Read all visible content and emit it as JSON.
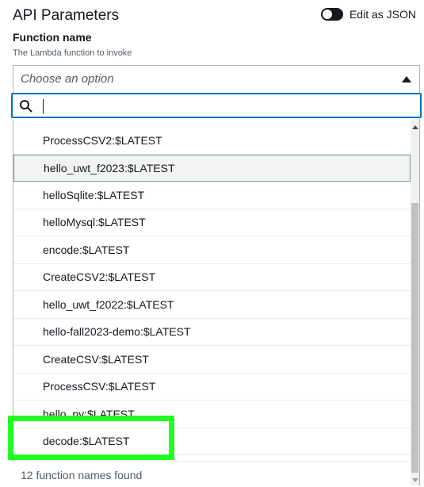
{
  "header": {
    "title": "API Parameters",
    "edit_json_label": "Edit as JSON"
  },
  "field": {
    "label": "Function name",
    "description": "The Lambda function to invoke",
    "select_placeholder": "Choose an option"
  },
  "options": [
    "ProcessCSV2:$LATEST",
    "hello_uwt_f2023:$LATEST",
    "helloSqlite:$LATEST",
    "helloMysql:$LATEST",
    "encode:$LATEST",
    "CreateCSV2:$LATEST",
    "hello_uwt_f2022:$LATEST",
    "hello-fall2023-demo:$LATEST",
    "CreateCSV:$LATEST",
    "ProcessCSV:$LATEST",
    "hello_py:$LATEST",
    "decode:$LATEST"
  ],
  "status_text": "12 function names found",
  "colors": {
    "highlight": "#22ff22",
    "focus_border": "#0073bb"
  }
}
